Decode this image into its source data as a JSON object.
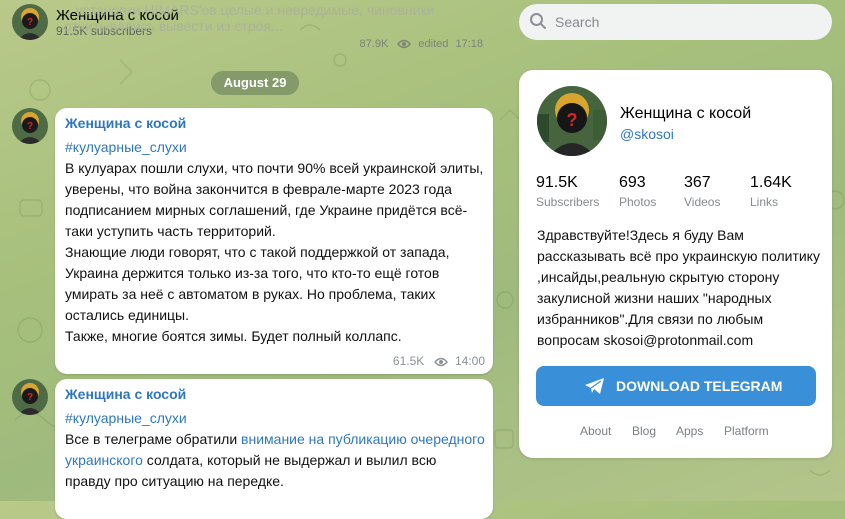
{
  "channel": {
    "title": "Женщина с косой",
    "subscribers": "91.5K subscribers"
  },
  "search": {
    "placeholder": "Search"
  },
  "previous_message": {
    "text_line1": "...установки HIMARS'ов целые и невредимые, чиновники",
    "text_line2": "отчитывались вывести из строя...",
    "views": "87.9K",
    "edited": "edited",
    "time": "17:18"
  },
  "date_separator": "August 29",
  "messages": [
    {
      "author": "Женщина с косой",
      "hashtag": "#кулуарные_слухи",
      "paragraphs": [
        "В кулуарах пошли слухи, что почти 90% всей украинской элиты, уверены, что война закончится в феврале-марте 2023 года подписанием мирных соглашений, где Украине придётся всё-таки уступить часть территорий.",
        "Знающие люди говорят, что с такой поддержкой от запада, Украина держится только из-за того, что кто-то ещё готов умирать за неё с автоматом в руках. Но проблема, таких остались единицы.",
        "Также, многие боятся зимы. Будет полный коллапс."
      ],
      "views": "61.5K",
      "time": "14:00"
    },
    {
      "author": "Женщина с косой",
      "hashtag": "#кулуарные_слухи",
      "text_before_link": "Все в телеграме обратили ",
      "link1": "внимание на публикацию",
      "link2": "очередного украинского",
      "text_after_link": " солдата, который не выдержал и вылил всю правду про ситуацию на передке."
    }
  ],
  "panel": {
    "name": "Женщина с косой",
    "handle": "@skosoi",
    "stats": [
      {
        "value": "91.5K",
        "label": "Subscribers"
      },
      {
        "value": "693",
        "label": "Photos"
      },
      {
        "value": "367",
        "label": "Videos"
      },
      {
        "value": "1.64K",
        "label": "Links"
      }
    ],
    "description": "Здравствуйте!Здесь я буду Вам рассказывать всё про украинскую политику ,инсайды,реальную скрытую сторону закулисной жизни наших \"народных избранников\".Для связи по любым вопросам skosoi@protonmail.com",
    "download_label": "DOWNLOAD TELEGRAM",
    "footer_links": [
      "About",
      "Blog",
      "Apps",
      "Platform"
    ]
  },
  "colors": {
    "accent": "#2e77c0",
    "button": "#3a8fd9",
    "date_pill": "#748960"
  },
  "icons": [
    "search-icon",
    "eye-icon",
    "telegram-plane-icon"
  ]
}
